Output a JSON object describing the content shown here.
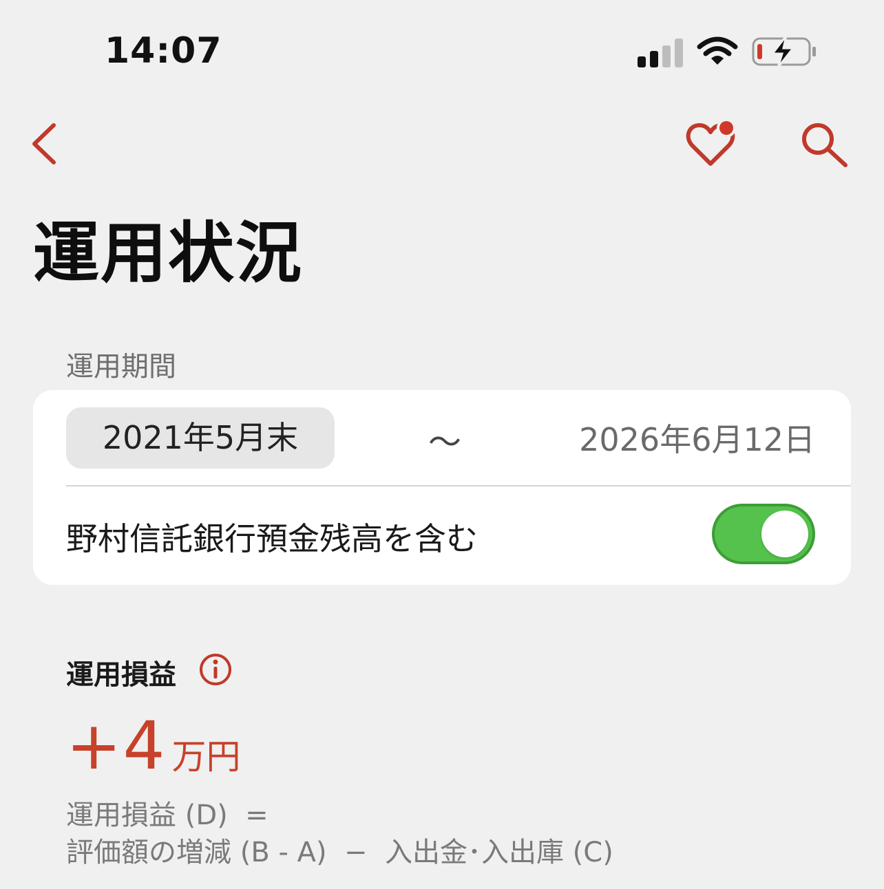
{
  "status_bar": {
    "time": "14:07",
    "battery_color": "#d0392a",
    "bolt_icon": "charging-bolt-icon"
  },
  "nav": {
    "back_icon": "chevron-left-icon",
    "favorite_icon": "heart-badge-icon",
    "search_icon": "search-icon",
    "accent_color": "#c0392b",
    "badge_color": "#d0392a"
  },
  "page": {
    "title": "運用状況"
  },
  "period": {
    "label": "運用期間",
    "start": "2021年5月末",
    "separator": "～",
    "end": "2026年6月12日"
  },
  "include_deposit": {
    "label": "野村信託銀行預金残高を含む",
    "enabled": true,
    "on_color": "#54c24c"
  },
  "pl": {
    "label": "運用損益",
    "info_icon": "info-circle-icon",
    "value": "+4",
    "unit": "万円",
    "value_color": "#c8412a",
    "formula_line1": "運用損益 (D)  =",
    "formula_line2": "評価額の増減 (B - A)  −  入出金･入出庫 (C)"
  }
}
